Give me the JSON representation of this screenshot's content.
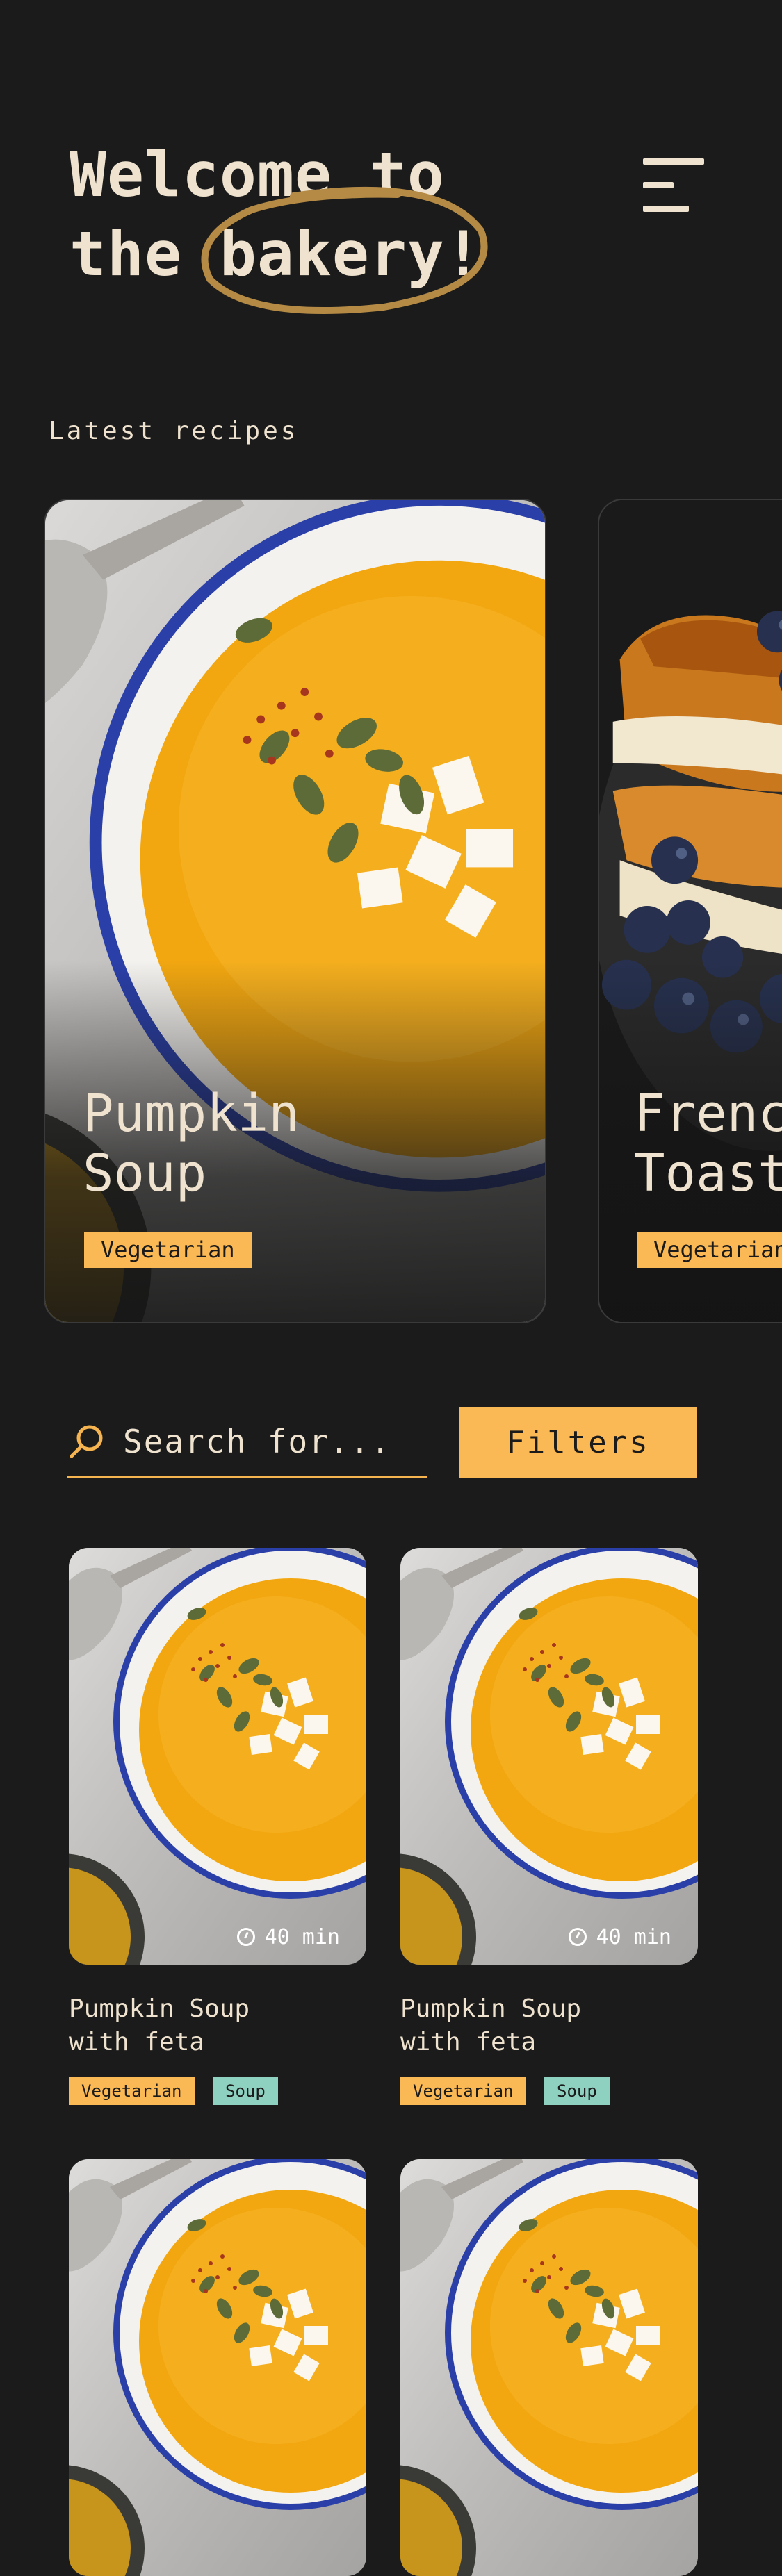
{
  "header": {
    "title_line1": "Welcome to",
    "title_line2": "the bakery!",
    "accent": "#b48a45",
    "menu_icon": "hamburger-menu-icon"
  },
  "latest": {
    "heading": "Latest recipes",
    "cards": [
      {
        "title_line1": "Pumpkin",
        "title_line2": "Soup",
        "tag": "Vegetarian"
      },
      {
        "title_line1": "French",
        "title_line2": "Toast",
        "tag": "Vegetarian"
      }
    ]
  },
  "search": {
    "placeholder": "Search for...",
    "icon": "search-icon",
    "filters_label": "Filters"
  },
  "grid": [
    {
      "name_line1": "Pumpkin Soup",
      "name_line2": "with feta",
      "time": "40 min",
      "tags": [
        "Vegetarian",
        "Soup"
      ]
    },
    {
      "name_line1": "Pumpkin Soup",
      "name_line2": "with feta",
      "time": "40 min",
      "tags": [
        "Vegetarian",
        "Soup"
      ]
    },
    {
      "name_line1": "",
      "name_line2": "",
      "time": "",
      "tags": []
    },
    {
      "name_line1": "",
      "name_line2": "",
      "time": "",
      "tags": []
    }
  ],
  "colors": {
    "background": "#1b1b1b",
    "text": "#efe3cf",
    "primary": "#fbb955",
    "soup_tag": "#8fd1c0"
  }
}
